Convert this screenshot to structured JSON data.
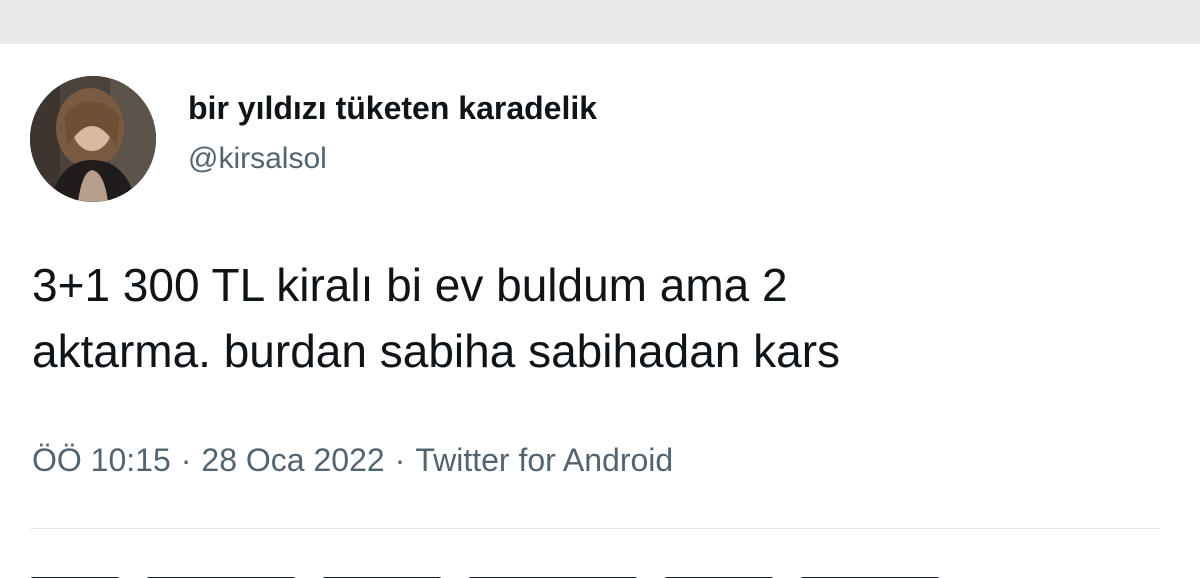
{
  "tweet": {
    "author": {
      "display_name": "bir yıldızı tüketen karadelik",
      "handle": "@kirsalsol"
    },
    "text_lines": [
      "3+1 300 TL kiralı bi ev buldum ama 2",
      "aktarma. burdan sabiha sabihadan kars"
    ],
    "meta": {
      "time": "ÖÖ 10:15",
      "date": "28 Oca 2022",
      "separator": "·",
      "source": "Twitter for Android"
    }
  },
  "colors": {
    "text_primary": "#0f1419",
    "text_secondary": "#536471",
    "top_strip": "#e9e9ea",
    "divider": "#e6e9ec"
  }
}
